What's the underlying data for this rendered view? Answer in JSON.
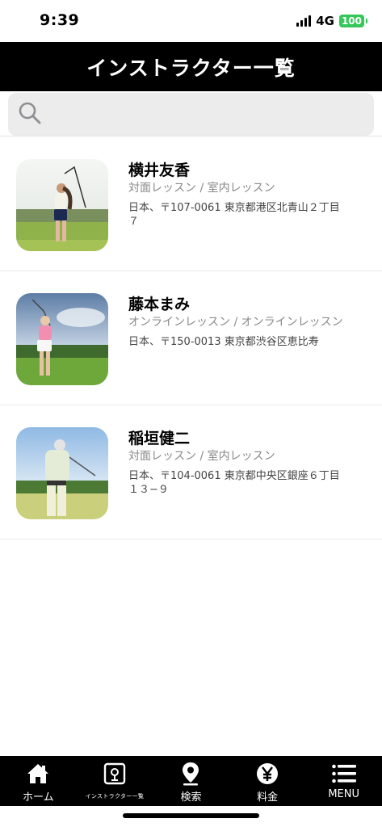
{
  "status_bar": {
    "time": "9:39",
    "network": "4G",
    "battery": "100",
    "battery_color": "#35c759"
  },
  "header": {
    "title": "インストラクター一覧"
  },
  "search": {
    "placeholder": "",
    "value": ""
  },
  "instructors": [
    {
      "name": "横井友香",
      "lesson_types": "対面レッスン / 室内レッスン",
      "address": "日本、〒107-0061 東京都港区北青山２丁目７"
    },
    {
      "name": "藤本まみ",
      "lesson_types": "オンラインレッスン / オンラインレッスン",
      "address": "日本、〒150-0013 東京都渋谷区恵比寿"
    },
    {
      "name": "稲垣健二",
      "lesson_types": "対面レッスン / 室内レッスン",
      "address": "日本、〒104-0061 東京都中央区銀座６丁目１３−９"
    }
  ],
  "tab_bar": {
    "items": [
      {
        "label": "ホーム",
        "icon": "home-icon"
      },
      {
        "label": "インストラクター一覧",
        "icon": "instructor-list-icon"
      },
      {
        "label": "検索",
        "icon": "map-pin-icon"
      },
      {
        "label": "料金",
        "icon": "yen-icon"
      },
      {
        "label": "MENU",
        "icon": "menu-icon"
      }
    ]
  },
  "colors": {
    "header_bg": "#000000",
    "tab_bg": "#000000",
    "search_bg": "#ececec"
  }
}
